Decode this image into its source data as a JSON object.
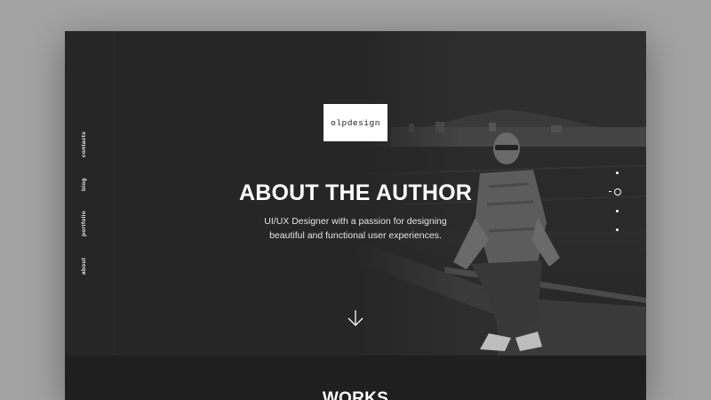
{
  "side_nav": {
    "items": [
      {
        "label": "contacts"
      },
      {
        "label": "blog"
      },
      {
        "label": "portfolio"
      },
      {
        "label": "about"
      }
    ]
  },
  "hero": {
    "logo_text": "olpdesign",
    "title": "ABOUT THE AUTHOR",
    "subtitle_line1": "UI/UX Designer with a passion for designing",
    "subtitle_line2": "beautiful and functional user experiences.",
    "scroll_icon": "arrow-down-icon"
  },
  "pagination": {
    "dot_count": 4,
    "active_index": 1
  },
  "works": {
    "title": "WORKS"
  },
  "colors": {
    "background": "#a3a3a3",
    "panel": "#252525",
    "accent": "#ffffff"
  }
}
